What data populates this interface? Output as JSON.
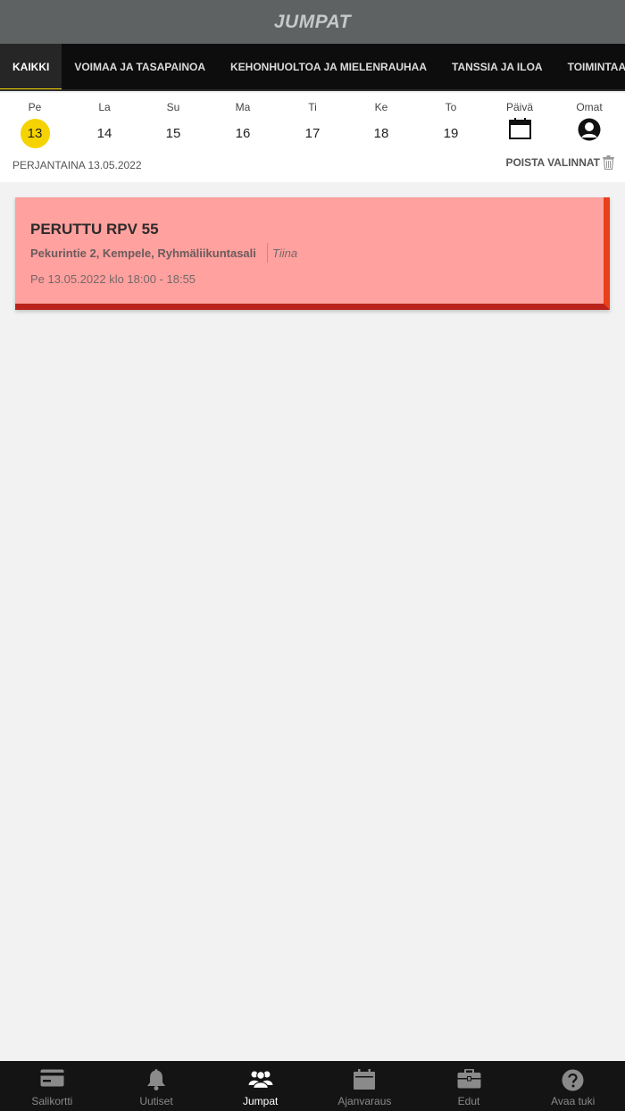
{
  "header": {
    "title": "JUMPAT"
  },
  "tabs": [
    {
      "label": "KAIKKI",
      "active": true
    },
    {
      "label": "VOIMAA JA TASAPAINOA"
    },
    {
      "label": "KEHONHUOLTOA JA MIELENRAUHAA"
    },
    {
      "label": "TANSSIA JA ILOA"
    },
    {
      "label": "TOIMINTAA JA RÄJÄHTÄVYYTTÄ"
    }
  ],
  "days": [
    {
      "name": "Pe",
      "date": "13",
      "selected": true
    },
    {
      "name": "La",
      "date": "14"
    },
    {
      "name": "Su",
      "date": "15"
    },
    {
      "name": "Ma",
      "date": "16"
    },
    {
      "name": "Ti",
      "date": "17"
    },
    {
      "name": "Ke",
      "date": "18"
    },
    {
      "name": "To",
      "date": "19"
    }
  ],
  "day_view": {
    "label": "Päivä",
    "icon": "calendar-icon"
  },
  "own_view": {
    "label": "Omat",
    "icon": "user-icon"
  },
  "date_label": "PERJANTAINA 13.05.2022",
  "clear_label": "POISTA VALINNAT",
  "classes": [
    {
      "title": "PERUTTU RPV 55",
      "location": "Pekurintie 2, Kempele, Ryhmäliikuntasali",
      "instructor": "Tiina",
      "time": "Pe 13.05.2022 klo 18:00 - 18:55",
      "status_colors": {
        "background": "#ffa19f",
        "accent": "#e8401a"
      }
    }
  ],
  "bottom_nav": [
    {
      "label": "Salikortti",
      "icon": "card-icon"
    },
    {
      "label": "Uutiset",
      "icon": "bell-icon"
    },
    {
      "label": "Jumpat",
      "icon": "group-icon",
      "active": true
    },
    {
      "label": "Ajanvaraus",
      "icon": "calendar-icon"
    },
    {
      "label": "Edut",
      "icon": "briefcase-icon"
    },
    {
      "label": "Avaa tuki",
      "icon": "help-icon"
    }
  ],
  "colors": {
    "accent": "#f5d300",
    "topbar": "#5f6263",
    "nav_bg": "#141414"
  }
}
